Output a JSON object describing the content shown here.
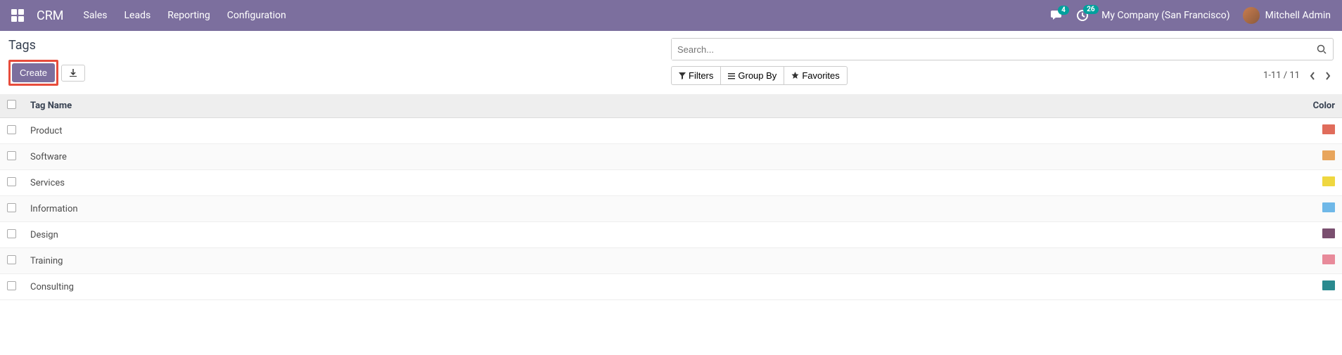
{
  "navbar": {
    "app_name": "CRM",
    "menu": [
      "Sales",
      "Leads",
      "Reporting",
      "Configuration"
    ],
    "messages_badge": "4",
    "activities_badge": "26",
    "company": "My Company (San Francisco)",
    "user": "Mitchell Admin"
  },
  "breadcrumb": "Tags",
  "buttons": {
    "create": "Create"
  },
  "search": {
    "placeholder": "Search..."
  },
  "filters": {
    "filters": "Filters",
    "group_by": "Group By",
    "favorites": "Favorites"
  },
  "pager": {
    "range": "1-11",
    "total": "11"
  },
  "table": {
    "headers": {
      "name": "Tag Name",
      "color": "Color"
    },
    "rows": [
      {
        "name": "Product",
        "color": "#e06c5b"
      },
      {
        "name": "Software",
        "color": "#e8a55c"
      },
      {
        "name": "Services",
        "color": "#efd740"
      },
      {
        "name": "Information",
        "color": "#6fb8e8"
      },
      {
        "name": "Design",
        "color": "#7a4f6f"
      },
      {
        "name": "Training",
        "color": "#e88a9a"
      },
      {
        "name": "Consulting",
        "color": "#2a8a8f"
      }
    ]
  }
}
